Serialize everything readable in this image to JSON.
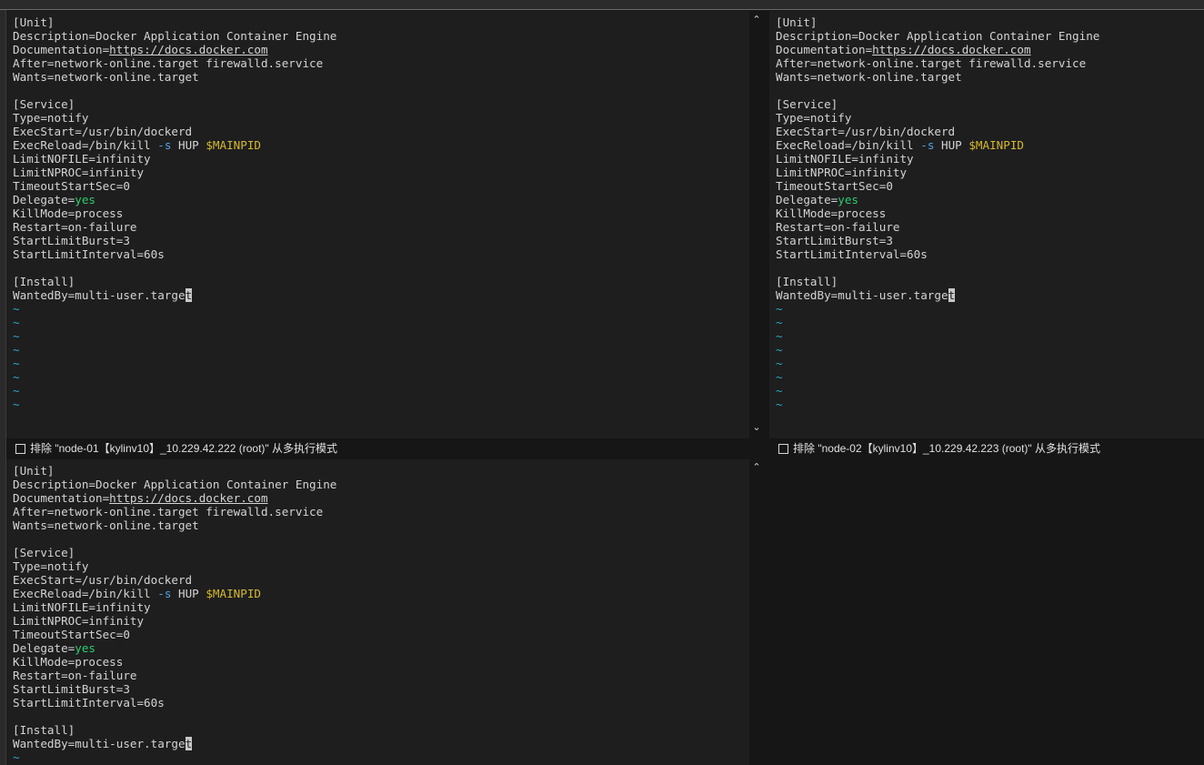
{
  "panes": [
    {
      "node_label": "排除 \"node-01【kylinv10】_10.229.42.222 (root)\" 从多执行模式",
      "lines": [
        [
          {
            "t": "[Unit]"
          }
        ],
        [
          {
            "t": "Description=Docker Application Container Engine"
          }
        ],
        [
          {
            "t": "Documentation="
          },
          {
            "t": "https://docs.docker.com",
            "c": "link"
          }
        ],
        [
          {
            "t": "After=network-online.target firewalld.service"
          }
        ],
        [
          {
            "t": "Wants=network-online.target"
          }
        ],
        [
          {
            "t": ""
          }
        ],
        [
          {
            "t": "[Service]"
          }
        ],
        [
          {
            "t": "Type=notify"
          }
        ],
        [
          {
            "t": "ExecStart=/usr/bin/dockerd"
          }
        ],
        [
          {
            "t": "ExecReload=/bin/kill "
          },
          {
            "t": "-s",
            "c": "flag"
          },
          {
            "t": " HUP "
          },
          {
            "t": "$MAINPID",
            "c": "var"
          }
        ],
        [
          {
            "t": "LimitNOFILE=infinity"
          }
        ],
        [
          {
            "t": "LimitNPROC=infinity"
          }
        ],
        [
          {
            "t": "TimeoutStartSec=0"
          }
        ],
        [
          {
            "t": "Delegate="
          },
          {
            "t": "yes",
            "c": "bool"
          }
        ],
        [
          {
            "t": "KillMode=process"
          }
        ],
        [
          {
            "t": "Restart=on-failure"
          }
        ],
        [
          {
            "t": "StartLimitBurst=3"
          }
        ],
        [
          {
            "t": "StartLimitInterval=60s"
          }
        ],
        [
          {
            "t": ""
          }
        ],
        [
          {
            "t": "[Install]"
          }
        ],
        [
          {
            "t": "WantedBy=multi-user.targe"
          },
          {
            "t": "t",
            "c": "cursor"
          }
        ],
        [
          {
            "t": "~",
            "c": "tilde"
          }
        ],
        [
          {
            "t": "~",
            "c": "tilde"
          }
        ],
        [
          {
            "t": "~",
            "c": "tilde"
          }
        ],
        [
          {
            "t": "~",
            "c": "tilde"
          }
        ],
        [
          {
            "t": "~",
            "c": "tilde"
          }
        ],
        [
          {
            "t": "~",
            "c": "tilde"
          }
        ],
        [
          {
            "t": "~",
            "c": "tilde"
          }
        ],
        [
          {
            "t": "~",
            "c": "tilde"
          }
        ]
      ]
    },
    {
      "node_label": "排除 \"node-02【kylinv10】_10.229.42.223 (root)\" 从多执行模式",
      "lines": [
        [
          {
            "t": "[Unit]"
          }
        ],
        [
          {
            "t": "Description=Docker Application Container Engine"
          }
        ],
        [
          {
            "t": "Documentation="
          },
          {
            "t": "https://docs.docker.com",
            "c": "link"
          }
        ],
        [
          {
            "t": "After=network-online.target firewalld.service"
          }
        ],
        [
          {
            "t": "Wants=network-online.target"
          }
        ],
        [
          {
            "t": ""
          }
        ],
        [
          {
            "t": "[Service]"
          }
        ],
        [
          {
            "t": "Type=notify"
          }
        ],
        [
          {
            "t": "ExecStart=/usr/bin/dockerd"
          }
        ],
        [
          {
            "t": "ExecReload=/bin/kill "
          },
          {
            "t": "-s",
            "c": "flag"
          },
          {
            "t": " HUP "
          },
          {
            "t": "$MAINPID",
            "c": "var"
          }
        ],
        [
          {
            "t": "LimitNOFILE=infinity"
          }
        ],
        [
          {
            "t": "LimitNPROC=infinity"
          }
        ],
        [
          {
            "t": "TimeoutStartSec=0"
          }
        ],
        [
          {
            "t": "Delegate="
          },
          {
            "t": "yes",
            "c": "bool"
          }
        ],
        [
          {
            "t": "KillMode=process"
          }
        ],
        [
          {
            "t": "Restart=on-failure"
          }
        ],
        [
          {
            "t": "StartLimitBurst=3"
          }
        ],
        [
          {
            "t": "StartLimitInterval=60s"
          }
        ],
        [
          {
            "t": ""
          }
        ],
        [
          {
            "t": "[Install]"
          }
        ],
        [
          {
            "t": "WantedBy=multi-user.targe"
          },
          {
            "t": "t",
            "c": "cursor"
          }
        ],
        [
          {
            "t": "~",
            "c": "tilde"
          }
        ],
        [
          {
            "t": "~",
            "c": "tilde"
          }
        ],
        [
          {
            "t": "~",
            "c": "tilde"
          }
        ],
        [
          {
            "t": "~",
            "c": "tilde"
          }
        ],
        [
          {
            "t": "~",
            "c": "tilde"
          }
        ],
        [
          {
            "t": "~",
            "c": "tilde"
          }
        ],
        [
          {
            "t": "~",
            "c": "tilde"
          }
        ],
        [
          {
            "t": "~",
            "c": "tilde"
          }
        ]
      ]
    },
    {
      "lines": [
        [
          {
            "t": "[Unit]"
          }
        ],
        [
          {
            "t": "Description=Docker Application Container Engine"
          }
        ],
        [
          {
            "t": "Documentation="
          },
          {
            "t": "https://docs.docker.com",
            "c": "link"
          }
        ],
        [
          {
            "t": "After=network-online.target firewalld.service"
          }
        ],
        [
          {
            "t": "Wants=network-online.target"
          }
        ],
        [
          {
            "t": ""
          }
        ],
        [
          {
            "t": "[Service]"
          }
        ],
        [
          {
            "t": "Type=notify"
          }
        ],
        [
          {
            "t": "ExecStart=/usr/bin/dockerd"
          }
        ],
        [
          {
            "t": "ExecReload=/bin/kill "
          },
          {
            "t": "-s",
            "c": "flag"
          },
          {
            "t": " HUP "
          },
          {
            "t": "$MAINPID",
            "c": "var"
          }
        ],
        [
          {
            "t": "LimitNOFILE=infinity"
          }
        ],
        [
          {
            "t": "LimitNPROC=infinity"
          }
        ],
        [
          {
            "t": "TimeoutStartSec=0"
          }
        ],
        [
          {
            "t": "Delegate="
          },
          {
            "t": "yes",
            "c": "bool"
          }
        ],
        [
          {
            "t": "KillMode=process"
          }
        ],
        [
          {
            "t": "Restart=on-failure"
          }
        ],
        [
          {
            "t": "StartLimitBurst=3"
          }
        ],
        [
          {
            "t": "StartLimitInterval=60s"
          }
        ],
        [
          {
            "t": ""
          }
        ],
        [
          {
            "t": "[Install]"
          }
        ],
        [
          {
            "t": "WantedBy=multi-user.targe"
          },
          {
            "t": "t",
            "c": "cursor"
          }
        ],
        [
          {
            "t": "~",
            "c": "tilde"
          }
        ]
      ]
    }
  ],
  "icons": {
    "scroll_up": "chevron-up-icon",
    "scroll_down": "chevron-down-icon",
    "checkbox": "checkbox-icon"
  },
  "colors": {
    "pane_bg": "#1e1e1e",
    "text": "#d4d4d4",
    "tilde": "#2aa7c9",
    "flag": "#4ea3e0",
    "variable": "#d7ba2f",
    "boolean": "#2ecc71"
  }
}
